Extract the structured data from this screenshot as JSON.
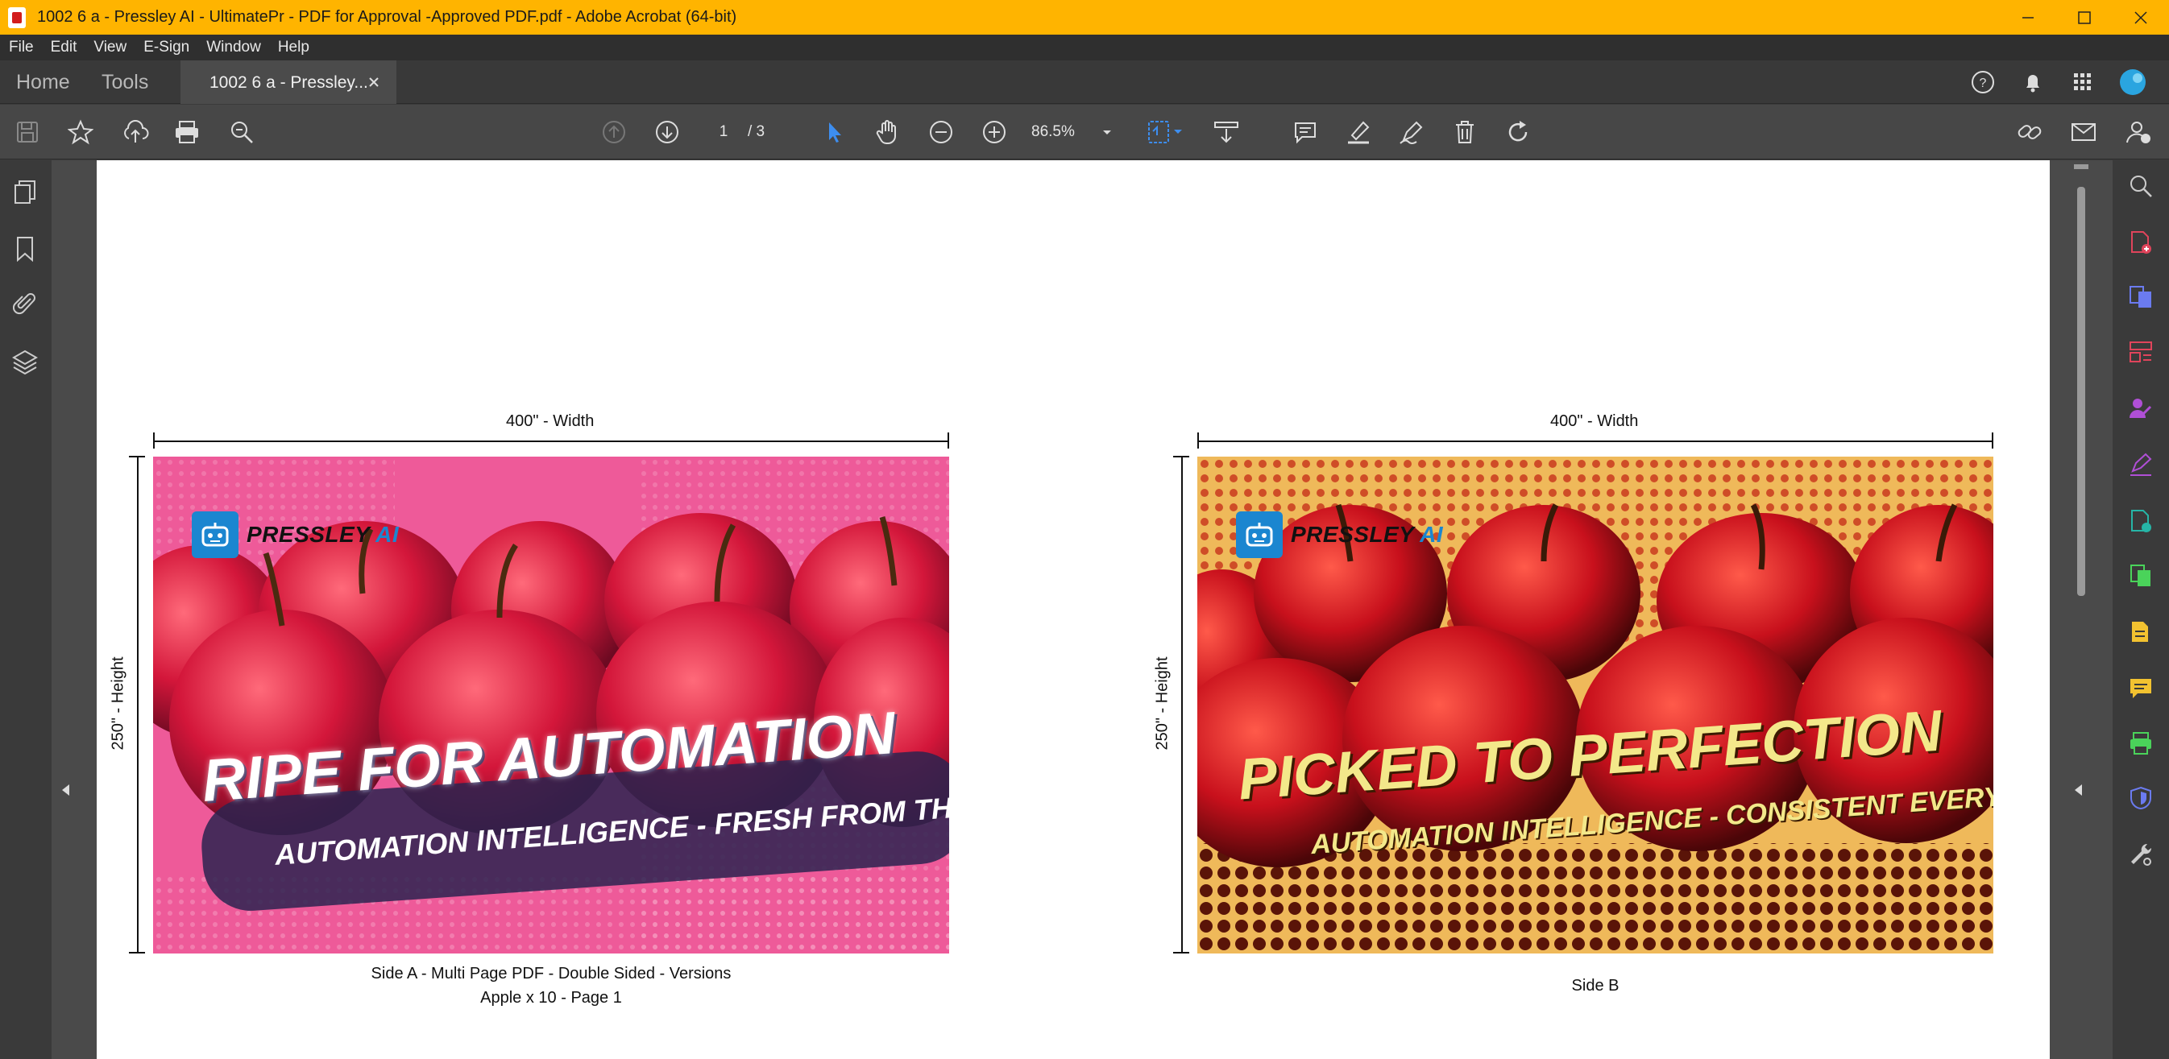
{
  "window": {
    "title": "1002  6 a - Pressley AI - UltimatePr - PDF for Approval -Approved PDF.pdf - Adobe Acrobat (64-bit)",
    "titlebar_color": "#ffb400"
  },
  "menu": [
    "File",
    "Edit",
    "View",
    "E-Sign",
    "Window",
    "Help"
  ],
  "tabs": {
    "home": "Home",
    "tools": "Tools",
    "document": "1002  6 a - Pressley..."
  },
  "toolbar": {
    "page_current": "1",
    "page_total": "/ 3",
    "zoom": "86.5%"
  },
  "document": {
    "side_a": {
      "width_label": "400\" - Width",
      "height_label": "250\" - Height",
      "brand": "PRESSLEY",
      "brand_ai": "AI",
      "headline": "RIPE FOR AUTOMATION",
      "subline": "AUTOMATION INTELLIGENCE - FRESH FROM THE TREE",
      "caption_line1": "Side A - Multi Page PDF - Double Sided - Versions",
      "caption_line2": "Apple x 10 - Page 1"
    },
    "side_b": {
      "width_label": "400\" - Width",
      "height_label": "250\" - Height",
      "brand": "PRESSLEY",
      "brand_ai": "AI",
      "headline": "PICKED TO PERFECTION",
      "subline": "AUTOMATION INTELLIGENCE - CONSISTENT EVERY TIME",
      "caption": "Side B"
    }
  },
  "icons": {
    "left_panel": [
      "pages-icon",
      "bookmark-icon",
      "attachment-icon",
      "layers-icon"
    ],
    "right_panel": [
      "search-zoom-icon",
      "create-pdf-icon",
      "combine-files-icon",
      "organize-pages-icon",
      "request-signature-icon",
      "fill-sign-icon",
      "export-pdf-icon",
      "edit-pdf-icon",
      "scan-ocr-icon",
      "comment-icon",
      "print-production-icon",
      "protect-icon",
      "more-tools-icon"
    ]
  },
  "colors": {
    "accent_blue": "#1b86d0",
    "side_a_bg": "#ee5a99",
    "side_b_bg": "#efb95a"
  }
}
